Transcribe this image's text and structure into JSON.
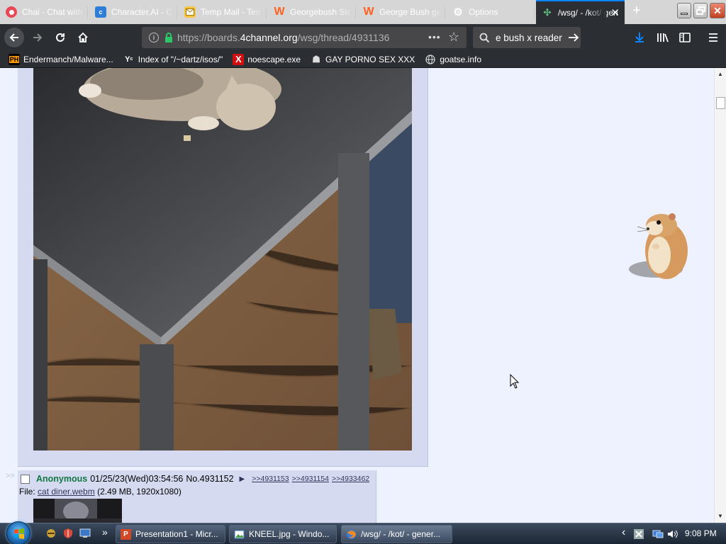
{
  "tabs": [
    {
      "label": "Chai - Chat with AI",
      "icon": "chai-icon",
      "color": "#e84855"
    },
    {
      "label": "Character.AI - Chat",
      "icon": "characterai-icon",
      "color": "#2e7dd7"
    },
    {
      "label": "Temp Mail - Temporary",
      "icon": "tempmail-icon",
      "color": "#f5c542"
    },
    {
      "label": "Georgebush Stories",
      "icon": "wattpad-icon",
      "color": "#ff6122"
    },
    {
      "label": "George Bush gets",
      "icon": "wattpad-icon",
      "color": "#ff6122"
    },
    {
      "label": "Options",
      "icon": "gear-icon",
      "color": "#ffffff"
    },
    {
      "label": "/wsg/ - /kot/ gen",
      "icon": "4chan-icon",
      "color": "#5bb87a",
      "active": true
    }
  ],
  "nav": {
    "url_prefix": "https://boards.",
    "url_domain": "4channel.org",
    "url_path": "/wsg/thread/4931136",
    "search_text": "e bush x reader"
  },
  "bookmarks": [
    {
      "label": "Endermanch/Malware...",
      "icon": "pornhub-icon"
    },
    {
      "label": "Index of \"/~dartz/isos/\"",
      "icon": "yc-icon"
    },
    {
      "label": "noescape.exe",
      "icon": "x-icon"
    },
    {
      "label": "GAY PORNO SEX XXX",
      "icon": "guy-icon"
    },
    {
      "label": "goatse.info",
      "icon": "globe-icon"
    }
  ],
  "post": {
    "name": "Anonymous",
    "datetime": "01/25/23(Wed)03:54:56",
    "number": "No.4931152",
    "replies": [
      ">>4931153",
      ">>4931154",
      ">>4933462"
    ],
    "file_prefix": "File: ",
    "file_name": "cat diner.webm",
    "file_meta": "(2.49 MB, 1920x1080)"
  },
  "side_arrows": ">>",
  "taskbar": {
    "items": [
      {
        "label": "Presentation1 - Micr...",
        "icon": "powerpoint-icon"
      },
      {
        "label": "KNEEL.jpg - Windo...",
        "icon": "image-viewer-icon"
      },
      {
        "label": "/wsg/ - /kot/ - gener...",
        "icon": "firefox-icon"
      }
    ],
    "clock": "9:08 PM",
    "overflow": "»",
    "tray_arrow": "‹"
  }
}
